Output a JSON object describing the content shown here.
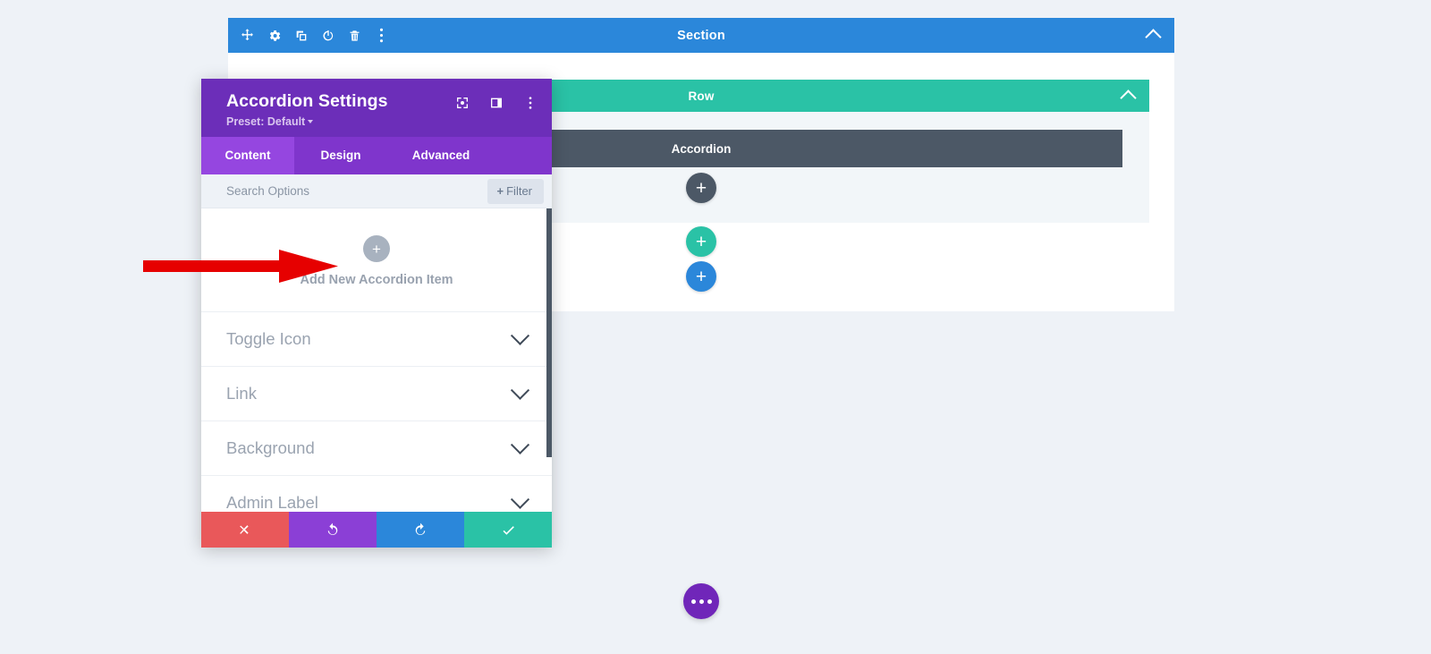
{
  "canvas": {
    "section": {
      "label": "Section",
      "color": "#2b87da",
      "toolbar_icons": [
        {
          "name": "move-icon",
          "glyph": "move"
        },
        {
          "name": "gear-icon",
          "glyph": "gear"
        },
        {
          "name": "duplicate-icon",
          "glyph": "duplicate"
        },
        {
          "name": "power-icon",
          "glyph": "power"
        },
        {
          "name": "trash-icon",
          "glyph": "trash"
        },
        {
          "name": "kebab-menu-icon",
          "glyph": "kebab"
        }
      ],
      "collapse_icon": "chevron-up-icon"
    },
    "row": {
      "label": "Row",
      "color": "#2ac2a6",
      "collapse_icon": "chevron-up-icon"
    },
    "module": {
      "label": "Accordion",
      "color": "#4c5866"
    },
    "add_buttons": {
      "module": "+",
      "row": "+",
      "section": "+"
    },
    "fab": {
      "name": "page-settings-fab",
      "color": "#7026b9",
      "dots": 3
    }
  },
  "modal": {
    "title": "Accordion Settings",
    "preset": "Preset: Default",
    "header_icons": [
      {
        "name": "focus-mode-icon"
      },
      {
        "name": "panel-layout-icon"
      },
      {
        "name": "kebab-menu-icon"
      }
    ],
    "tabs": [
      {
        "id": "content",
        "label": "Content",
        "active": true
      },
      {
        "id": "design",
        "label": "Design",
        "active": false
      },
      {
        "id": "advanced",
        "label": "Advanced",
        "active": false
      }
    ],
    "search": {
      "placeholder": "Search Options",
      "value": ""
    },
    "filter_button": {
      "plus": "+",
      "label": "Filter"
    },
    "add_item": {
      "plus": "+",
      "label": "Add New Accordion Item"
    },
    "option_groups": [
      {
        "label": "Toggle Icon",
        "expanded": false
      },
      {
        "label": "Link",
        "expanded": false
      },
      {
        "label": "Background",
        "expanded": false
      },
      {
        "label": "Admin Label",
        "expanded": false
      }
    ],
    "footer_buttons": [
      {
        "name": "discard-button",
        "icon": "close-icon",
        "color": "#e9585a"
      },
      {
        "name": "undo-button",
        "icon": "undo-icon",
        "color": "#8b3fd6"
      },
      {
        "name": "redo-button",
        "icon": "redo-icon",
        "color": "#2b87da"
      },
      {
        "name": "save-button",
        "icon": "check-icon",
        "color": "#2ac2a6"
      }
    ],
    "accent_header_color": "#6c2eb9",
    "accent_tab_color": "#9546e0"
  },
  "annotation": {
    "arrow": {
      "name": "red-arrow-annotation",
      "color": "#e60000",
      "direction": "right",
      "points_to": "Add New Accordion Item"
    }
  }
}
